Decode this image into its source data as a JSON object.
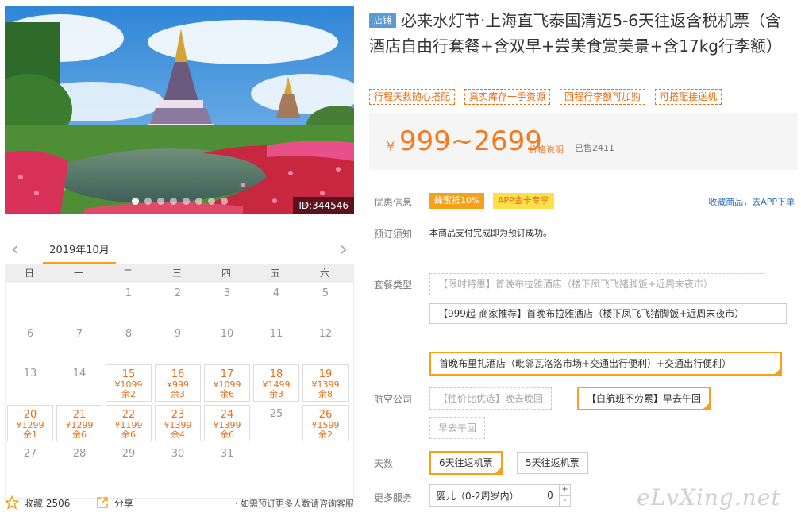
{
  "gallery": {
    "id_label": "ID:344546",
    "slides": 8,
    "active_slide": 1
  },
  "calendar": {
    "month": "2019年10月",
    "weekdays": [
      "日",
      "一",
      "二",
      "三",
      "四",
      "五",
      "六"
    ],
    "leading_blanks": 2,
    "days": [
      {
        "d": "1"
      },
      {
        "d": "2"
      },
      {
        "d": "3"
      },
      {
        "d": "4"
      },
      {
        "d": "5"
      },
      {
        "d": "6"
      },
      {
        "d": "7"
      },
      {
        "d": "8"
      },
      {
        "d": "9"
      },
      {
        "d": "10"
      },
      {
        "d": "11"
      },
      {
        "d": "12"
      },
      {
        "d": "13"
      },
      {
        "d": "14"
      },
      {
        "d": "15",
        "price": "¥1099",
        "stock": "余2"
      },
      {
        "d": "16",
        "price": "¥999",
        "stock": "余3"
      },
      {
        "d": "17",
        "price": "¥1099",
        "stock": "余6"
      },
      {
        "d": "18",
        "price": "¥1499",
        "stock": "余3"
      },
      {
        "d": "19",
        "price": "¥1399",
        "stock": "余8"
      },
      {
        "d": "20",
        "price": "¥1299",
        "stock": "余1"
      },
      {
        "d": "21",
        "price": "¥1299",
        "stock": "余6"
      },
      {
        "d": "22",
        "price": "¥1199",
        "stock": "余6"
      },
      {
        "d": "23",
        "price": "¥1399",
        "stock": "余4"
      },
      {
        "d": "24",
        "price": "¥1399",
        "stock": "余6"
      },
      {
        "d": "25"
      },
      {
        "d": "26",
        "price": "¥1599",
        "stock": "余2"
      },
      {
        "d": "27"
      },
      {
        "d": "28"
      },
      {
        "d": "29"
      },
      {
        "d": "30"
      },
      {
        "d": "31"
      }
    ]
  },
  "footer": {
    "fav": "收藏 2506",
    "share": "分享",
    "tip": "· 如需预订更多人数请咨询客服"
  },
  "product": {
    "shop_badge": "店铺",
    "title": "必来水灯节·上海直飞泰国清迈5-6天往返含税机票（含酒店自由行套餐+含双早+尝美食赏美景+含17kg行李额）",
    "tags": [
      "行程天数随心搭配",
      "真实库存一手资源",
      "回程行李额可加购",
      "可搭配接送机"
    ],
    "price_currency": "¥",
    "price_range": "999~2699",
    "price_explain": "价格说明",
    "sold": "已售2411"
  },
  "info": {
    "promo_label": "优惠信息",
    "promo_1": "蜂蜜抵10%",
    "promo_2": "APP金卡专享",
    "fav_link": "收藏商品，去APP下单",
    "notice_label": "预订须知",
    "notice_text": "本商品支付完成即为预订成功。"
  },
  "options": {
    "package_label": "套餐类型",
    "package_1": "【限时特惠】首晚布拉雅酒店（楼下凤飞飞猪脚饭+近周末夜市）",
    "package_2": "【999起-商家推荐】首晚布拉雅酒店（楼下凤飞飞猪脚饭+近周末夜市）",
    "package_3": "首晚布里扎酒店（毗邻瓦洛洛市场+交通出行便利）+交通出行便利）",
    "airline_label": "航空公司",
    "airline_1": "【性价比优选】晚去晚回",
    "airline_2": "【白航班不劳累】早去午回",
    "airline_3": "早去午回",
    "days_label": "天数",
    "days_1": "6天往返机票",
    "days_2": "5天往返机票",
    "more_label": "更多服务",
    "infant_label": "婴儿（0-2周岁内）",
    "infant_count": "0"
  },
  "watermark": "eLvXing.net",
  "colors": {
    "accent": "#f7a01b",
    "price": "#f57a1f",
    "link": "#2f6fc1",
    "shop_badge": "#5b9bd5"
  }
}
